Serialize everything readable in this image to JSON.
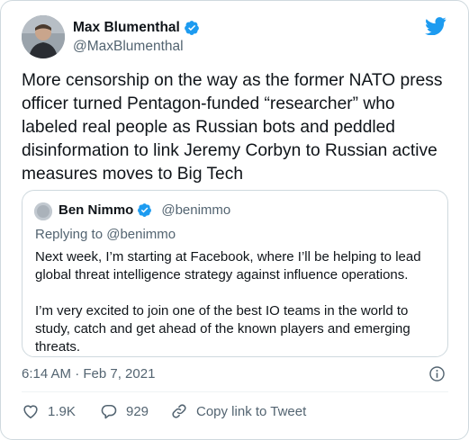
{
  "author": {
    "name": "Max Blumenthal",
    "handle": "@MaxBlumenthal"
  },
  "tweet": {
    "text": "More censorship on the way as the former NATO press officer turned Pentagon-funded “researcher” who labeled real people as Russian bots and peddled disinformation to link Jeremy Corbyn to Russian active measures moves to Big Tech",
    "timestamp": "6:14 AM · Feb 7, 2021"
  },
  "quote": {
    "name": "Ben Nimmo",
    "handle": "@benimmo",
    "replying_prefix": "Replying to",
    "replying_to": "@benimmo",
    "paragraphs": [
      "Next week, I’m starting at Facebook, where I’ll be helping to lead global threat intelligence strategy against influence operations.",
      "I’m very excited to join one of the best IO teams in the world to study, catch and get ahead of the known players and emerging threats."
    ]
  },
  "actions": {
    "likes": "1.9K",
    "replies": "929",
    "copy_link": "Copy link to Tweet"
  },
  "colors": {
    "brand_blue": "#1d9bf0",
    "secondary_text": "#536471",
    "primary_text": "#0f1419",
    "border": "#cfd9de"
  },
  "icons": [
    "twitter-bird-icon",
    "verified-badge-icon",
    "info-icon",
    "heart-icon",
    "reply-bubble-icon",
    "link-icon"
  ]
}
